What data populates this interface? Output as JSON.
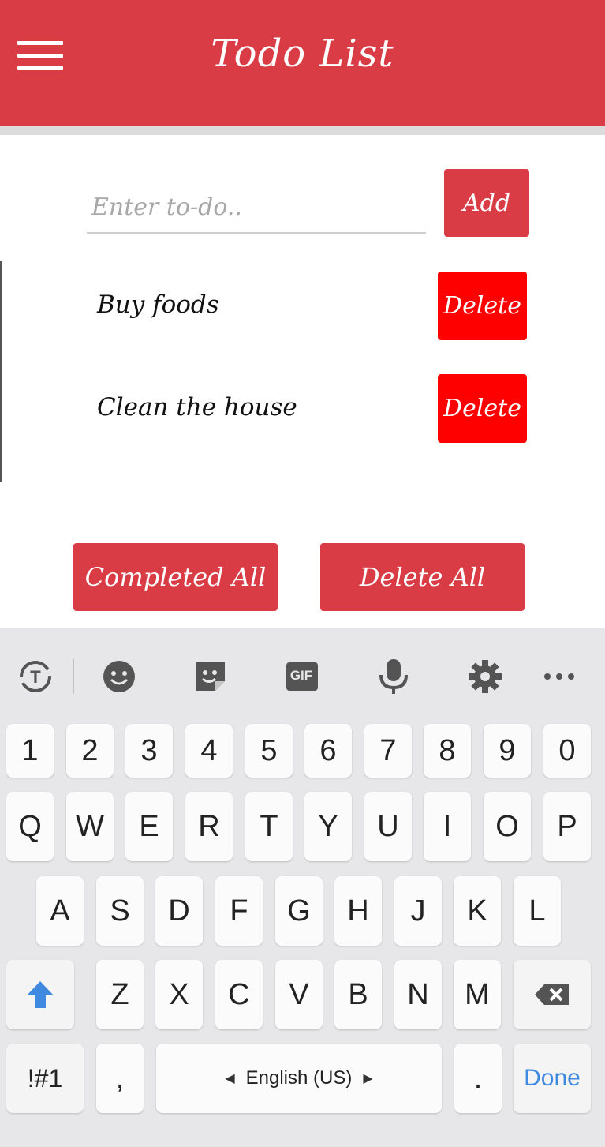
{
  "app": {
    "title": "Todo List",
    "colors": {
      "primary": "#d93c45",
      "delete": "#ff0000"
    }
  },
  "input": {
    "placeholder": "Enter to-do..",
    "value": ""
  },
  "add_label": "Add",
  "todos": [
    {
      "text": "Buy foods",
      "delete_label": "Delete"
    },
    {
      "text": "Clean the house",
      "delete_label": "Delete"
    }
  ],
  "actions": {
    "completed_all": "Completed All",
    "delete_all": "Delete All"
  },
  "keyboard": {
    "toolbar_icons": [
      "translate-icon",
      "emoji-icon",
      "sticker-icon",
      "gif-icon",
      "mic-icon",
      "settings-icon",
      "more-icon"
    ],
    "gif_label": "GIF",
    "row_numbers": [
      "1",
      "2",
      "3",
      "4",
      "5",
      "6",
      "7",
      "8",
      "9",
      "0"
    ],
    "row_top": [
      "Q",
      "W",
      "E",
      "R",
      "T",
      "Y",
      "U",
      "I",
      "O",
      "P"
    ],
    "row_mid": [
      "A",
      "S",
      "D",
      "F",
      "G",
      "H",
      "J",
      "K",
      "L"
    ],
    "row_bottom": [
      "Z",
      "X",
      "C",
      "V",
      "B",
      "N",
      "M"
    ],
    "symbols_label": "!#1",
    "comma_label": ",",
    "space_label": "English (US)",
    "period_label": ".",
    "done_label": "Done"
  }
}
